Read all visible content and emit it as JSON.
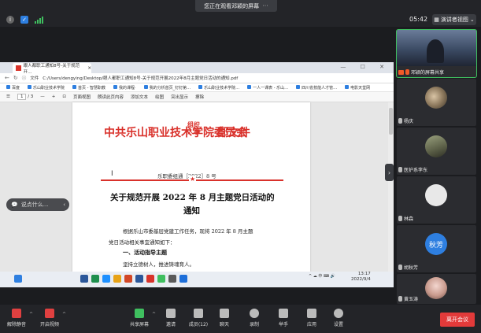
{
  "top": {
    "sharing_banner": "您正在观看邓颖的屏幕",
    "more": "···",
    "clock": "05:42",
    "view_button": "演讲者视图"
  },
  "browser": {
    "tab_title": "眼人都职工通知8号-关于规范开…",
    "window_controls": "— ☐ ✕",
    "address_label": "文件",
    "address": "C:/Users/dengying/Desktop/眼人都职工通知8号-关于规范开展2022年8月主题党日活动的通知.pdf",
    "bookmarks": [
      "百度",
      "乐山职业技术学院",
      "首页 - 智慧职教",
      "我的课程·",
      "我的分析首页_钉钉第…",
      "乐山职业技术学院…",
      "一人一课表 - 乐山…",
      "四川省技能人才管…",
      "电影天堂网"
    ],
    "pdf_toolbar": {
      "page_current": "1",
      "page_total": "/ 3",
      "items": [
        "页面视图",
        "朗读此页内容",
        "添加文本",
        "绘图",
        "突出显示",
        "擦除"
      ]
    }
  },
  "document": {
    "title_main": "中共乐山职业技术学院委员会",
    "title_org_top": "组织",
    "title_org_bottom": "人事",
    "title_tail": "部文件",
    "doc_number": "乐职委组通［2022］8 号",
    "star": "★",
    "heading_line1": "关于规范开展 2022 年 8 月主题党日活动的",
    "heading_line2": "通知",
    "body_line1": "根据乐山市委基层党建工作任务，现将 2022 年 8 月主题",
    "body_line2": "党日活动相关事宜通知如下：",
    "section1": "一、活动指导主题",
    "body_line3": "坚持立德树人，推进铸魂育人。"
  },
  "taskbar": {
    "search_placeholder": "说点什么...",
    "tray": "^ ☁ 中 ⌨ 🔊",
    "time": "13:17",
    "date": "2022/9/4"
  },
  "participants": [
    {
      "name": "邓颖的屏幕共享",
      "mic_on": true
    },
    {
      "name": "杨庆",
      "mic_on": false
    },
    {
      "name": "医护系李东",
      "mic_on": false
    },
    {
      "name": "林森",
      "mic_on": false
    },
    {
      "name": "胡秋芳",
      "mic_on": false,
      "avatar_text": "秋芳",
      "avatar_color": "#2e7fe0"
    },
    {
      "name": "黄玉涛",
      "mic_on": false
    }
  ],
  "bottom": {
    "unmute": "解除静音",
    "start_video": "开启视频",
    "share_screen": "共享屏幕",
    "invite": "邀请",
    "members": "成员(12)",
    "chat": "聊天",
    "record": "录制",
    "raise_hand": "举手",
    "apps": "应用",
    "settings": "设置",
    "leave": "离开会议"
  }
}
